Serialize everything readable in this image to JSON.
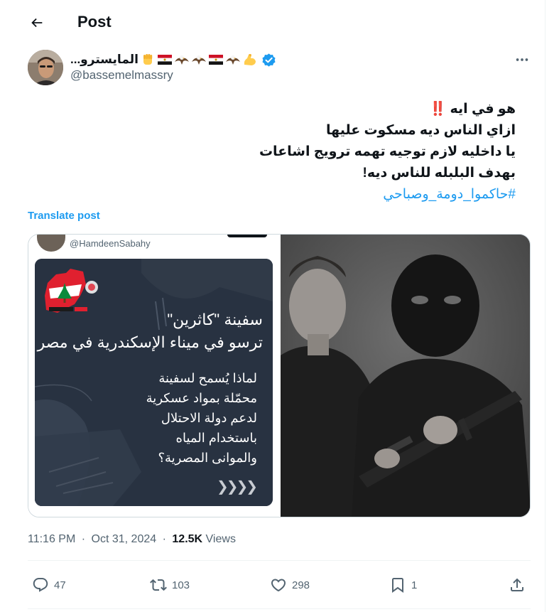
{
  "header": {
    "title": "Post"
  },
  "author": {
    "display_name": "...المايسترو",
    "handle": "@bassemelmassry",
    "name_emojis": [
      "raised-fist",
      "egypt-flag",
      "eagle",
      "eagle",
      "egypt-flag",
      "eagle",
      "flexed-biceps"
    ],
    "verified": true
  },
  "post": {
    "lines": [
      "هو في ايه ‼️",
      "ازاي الناس ديه مسكوت عليها",
      "يا داخليه لازم توجيه تهمه ترويج اشاعات",
      "بهدف البلبله للناس ديه!"
    ],
    "hashtag": "#حاكموا_دومة_وصباحي",
    "translate_label": "Translate post"
  },
  "media": {
    "embedded_handle": "@HamdeenSabahy",
    "card_title_lines": [
      "سفينة \"كاثرين\"",
      "ترسو في ميناء الإسكندرية في مصر"
    ],
    "card_body_lines": [
      "لماذا يُسمح لسفينة",
      "محمّلة بمواد عسكرية",
      "لدعم دولة الاحتلال",
      "باستخدام المياه",
      "والموانى المصرية؟"
    ],
    "arrows": "❯❯❯❯"
  },
  "meta": {
    "time": "11:16 PM",
    "date": "Oct 31, 2024",
    "views_count": "12.5K",
    "views_label": "Views",
    "separator": "·"
  },
  "actions": {
    "replies": "47",
    "reposts": "103",
    "likes": "298",
    "bookmarks": "1"
  },
  "colors": {
    "accent": "#1d9bf0",
    "text_primary": "#0f1419",
    "text_secondary": "#536471",
    "border": "#cfd9de",
    "egypt_red": "#ce1126",
    "egypt_gold": "#c09300"
  }
}
